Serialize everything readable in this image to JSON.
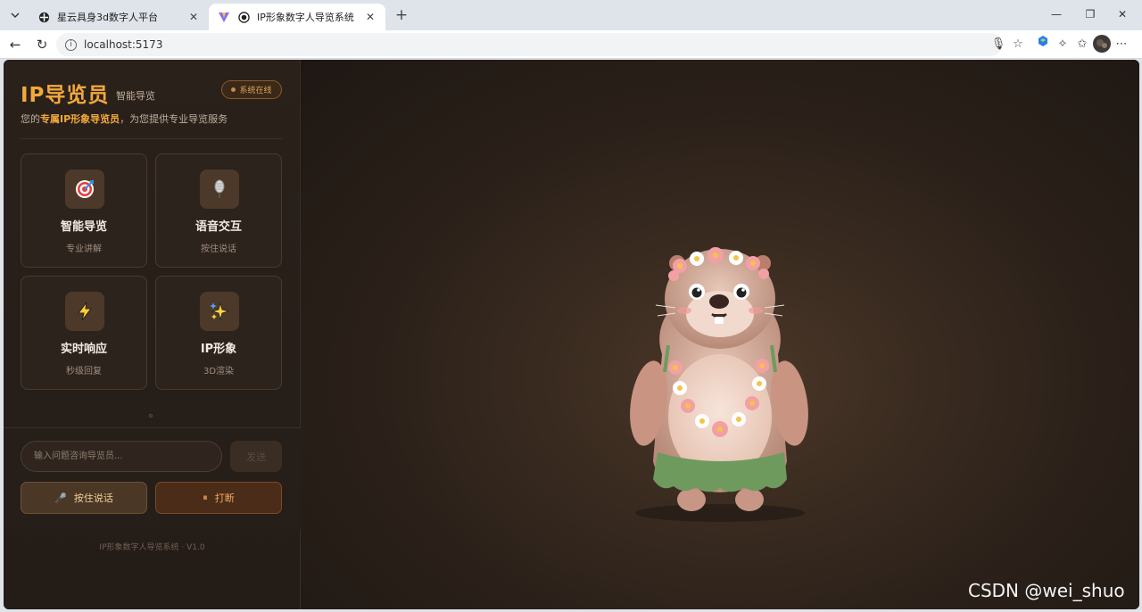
{
  "browser": {
    "tabs": [
      {
        "title": "星云具身3d数字人平台",
        "active": false
      },
      {
        "title": "IP形象数字人导览系统",
        "active": true
      }
    ],
    "url": "localhost:5173"
  },
  "sidebar": {
    "title": "IP导览员",
    "subtitle": "智能导览",
    "status": "系统在线",
    "desc_prefix": "您的",
    "desc_highlight": "专属IP形象导览员",
    "desc_suffix": "，为您提供专业导览服务",
    "cards": [
      {
        "icon": "target-icon",
        "title": "智能导览",
        "subtitle": "专业讲解"
      },
      {
        "icon": "microphone-icon",
        "title": "语音交互",
        "subtitle": "按住说话"
      },
      {
        "icon": "lightning-icon",
        "title": "实时响应",
        "subtitle": "秒级回复"
      },
      {
        "icon": "sparkles-icon",
        "title": "IP形象",
        "subtitle": "3D渲染"
      }
    ],
    "input_placeholder": "输入问题咨询导览员...",
    "send_label": "发送",
    "voice_label": "按住说话",
    "stop_label": "打断",
    "footer": "IP形象数字人导览系统 · V1.0"
  },
  "watermark": "CSDN @wei_shuo",
  "colors": {
    "accent": "#f2a93b",
    "background": "#1f1915",
    "card_border": "#4a3a2e"
  }
}
